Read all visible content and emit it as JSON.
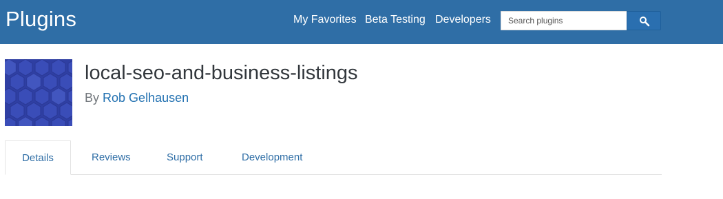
{
  "header": {
    "site_title": "Plugins",
    "nav": {
      "my_favorites": "My Favorites",
      "beta_testing": "Beta Testing",
      "developers": "Developers"
    },
    "search": {
      "placeholder": "Search plugins",
      "button_icon": "search-icon"
    },
    "background_color": "#2f6ea6"
  },
  "plugin": {
    "title": "local-seo-and-business-listings",
    "by_label": "By",
    "author": "Rob Gelhausen",
    "banner_icon": "hexagon-pattern-icon",
    "banner_color": "#3246a8"
  },
  "tabs": {
    "details": "Details",
    "reviews": "Reviews",
    "support": "Support",
    "development": "Development",
    "active": "Details"
  }
}
